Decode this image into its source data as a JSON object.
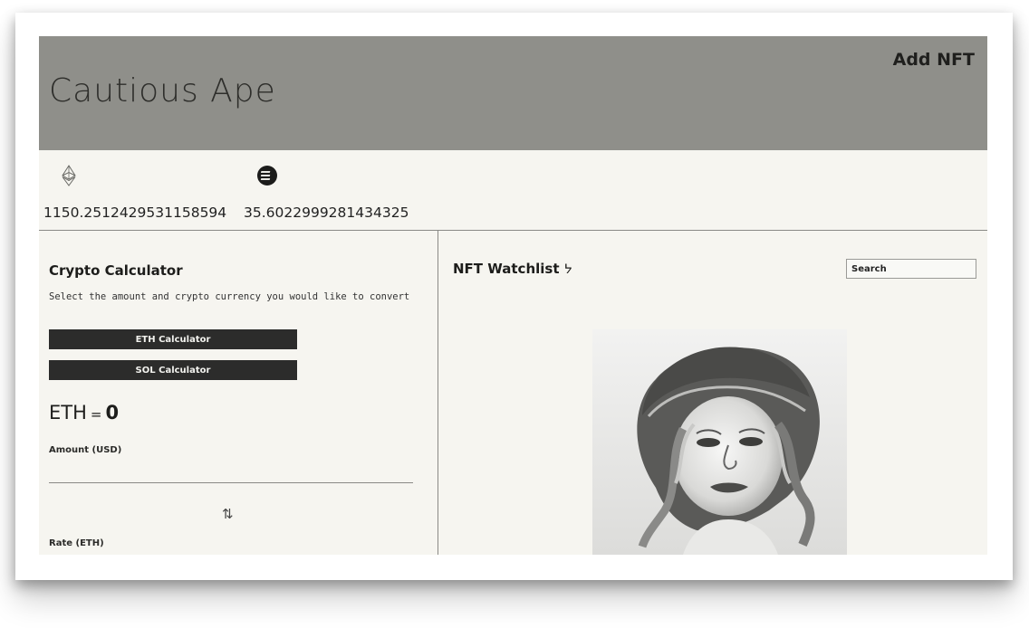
{
  "header": {
    "title": "Cautious Ape",
    "add_nft_label": "Add NFT"
  },
  "prices": [
    {
      "icon": "ethereum-icon",
      "value": "1150.2512429531158594"
    },
    {
      "icon": "solana-icon",
      "value": "35.6022999281434325"
    }
  ],
  "calculator": {
    "title": "Crypto Calculator",
    "subtitle": "Select the amount and crypto currency you would like to convert",
    "eth_button": "ETH Calculator",
    "sol_button": "SOL Calculator",
    "result_symbol": "ETH",
    "result_equals": "=",
    "result_value": "0",
    "amount_label": "Amount (USD)",
    "amount_value": "",
    "swap_icon": "swap-vertical-icon",
    "swap_glyph": "⇅",
    "rate_label": "Rate (ETH)"
  },
  "watchlist": {
    "title": "NFT Watchlist",
    "title_icon": "ᔭ",
    "search_placeholder": "Search"
  },
  "colors": {
    "header_bg": "#8f8f8a",
    "page_bg": "#f6f5f0",
    "button_bg": "#2c2c2b"
  }
}
